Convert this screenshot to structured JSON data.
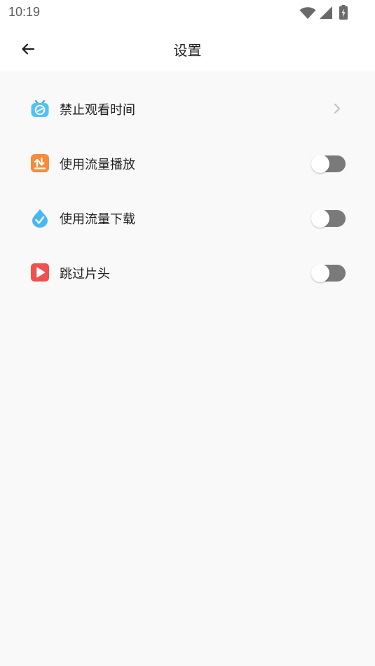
{
  "status_bar": {
    "time": "10:19",
    "icons": [
      "wifi-icon",
      "cell-signal-icon",
      "battery-charging-icon"
    ]
  },
  "app_bar": {
    "back_icon": "arrow-left-icon",
    "title": "设置"
  },
  "settings": {
    "items": [
      {
        "label": "禁止观看时间",
        "icon": "tv-clock-icon",
        "control": "chevron"
      },
      {
        "label": "使用流量播放",
        "icon": "data-play-icon",
        "control": "toggle",
        "on": false
      },
      {
        "label": "使用流量下载",
        "icon": "water-drop-download-icon",
        "control": "toggle",
        "on": false
      },
      {
        "label": "跳过片头",
        "icon": "play-skip-icon",
        "control": "toggle",
        "on": false
      }
    ]
  },
  "colors": {
    "background": "#f9f9f9",
    "toggle_off_track": "#7a7a7a",
    "chevron": "#c0c0c0",
    "icon_blue": "#45b8f5",
    "icon_orange": "#f88b3a",
    "icon_red": "#f0504f"
  }
}
